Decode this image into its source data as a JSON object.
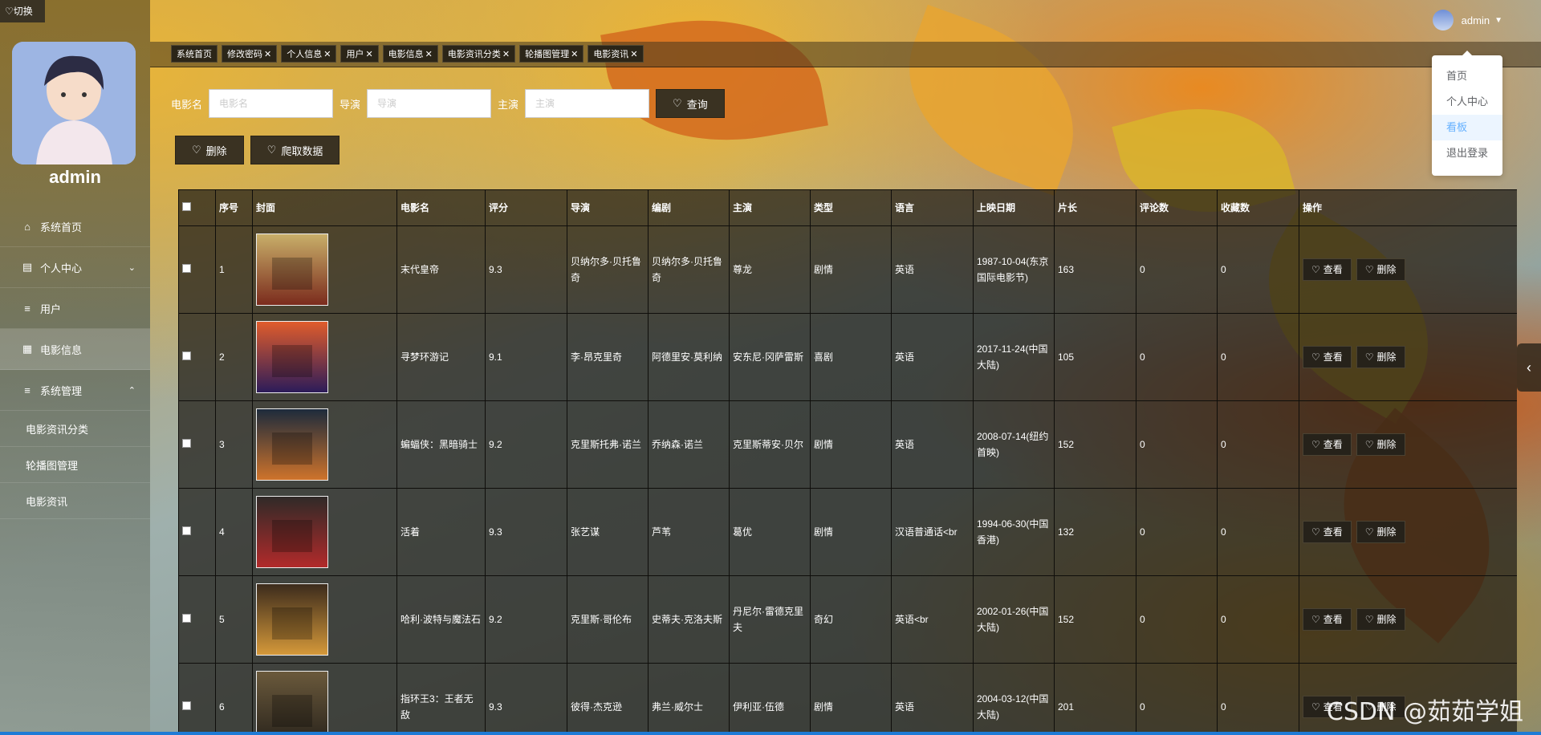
{
  "switch_label": "切换",
  "user": {
    "name": "admin"
  },
  "sidebar": {
    "items": [
      {
        "label": "系统首页",
        "icon": "home-icon"
      },
      {
        "label": "个人中心",
        "icon": "profile-icon"
      },
      {
        "label": "用户",
        "icon": "list-icon"
      },
      {
        "label": "电影信息",
        "icon": "grid-icon"
      },
      {
        "label": "系统管理",
        "icon": "list-icon"
      }
    ],
    "sub_items": [
      "电影资讯分类",
      "轮播图管理",
      "电影资讯"
    ]
  },
  "tabs": [
    "系统首页",
    "修改密码",
    "个人信息",
    "用户",
    "电影信息",
    "电影资讯分类",
    "轮播图管理",
    "电影资讯"
  ],
  "dropdown": [
    "首页",
    "个人中心",
    "看板",
    "退出登录"
  ],
  "search": {
    "fields": [
      {
        "label": "电影名",
        "placeholder": "电影名"
      },
      {
        "label": "导演",
        "placeholder": "导演"
      },
      {
        "label": "主演",
        "placeholder": "主演"
      }
    ],
    "button": "查询"
  },
  "actions": {
    "delete": "删除",
    "crawl": "爬取数据"
  },
  "table": {
    "headers": [
      "",
      "序号",
      "封面",
      "电影名",
      "评分",
      "导演",
      "编剧",
      "主演",
      "类型",
      "语言",
      "上映日期",
      "片长",
      "评论数",
      "收藏数",
      "操作"
    ],
    "rows": [
      {
        "no": "1",
        "name": "末代皇帝",
        "score": "9.3",
        "director": "贝纳尔多·贝托鲁奇",
        "writer": "贝纳尔多·贝托鲁奇",
        "cast": "尊龙",
        "genre": "剧情",
        "lang": "英语",
        "date": "1987-10-04(东京国际电影节)",
        "length": "163",
        "comments": "0",
        "favs": "0"
      },
      {
        "no": "2",
        "name": "寻梦环游记",
        "score": "9.1",
        "director": "李·昂克里奇",
        "writer": "阿德里安·莫利纳",
        "cast": "安东尼·冈萨雷斯",
        "genre": "喜剧",
        "lang": "英语",
        "date": "2017-11-24(中国大陆)",
        "length": "105",
        "comments": "0",
        "favs": "0"
      },
      {
        "no": "3",
        "name": "蝙蝠侠：黑暗骑士",
        "score": "9.2",
        "director": "克里斯托弗·诺兰",
        "writer": "乔纳森·诺兰",
        "cast": "克里斯蒂安·贝尔",
        "genre": "剧情",
        "lang": "英语",
        "date": "2008-07-14(纽约首映)",
        "length": "152",
        "comments": "0",
        "favs": "0"
      },
      {
        "no": "4",
        "name": "活着",
        "score": "9.3",
        "director": "张艺谋",
        "writer": "芦苇",
        "cast": "葛优",
        "genre": "剧情",
        "lang": "汉语普通话<br",
        "date": "1994-06-30(中国香港)",
        "length": "132",
        "comments": "0",
        "favs": "0"
      },
      {
        "no": "5",
        "name": "哈利·波特与魔法石",
        "score": "9.2",
        "director": "克里斯·哥伦布",
        "writer": "史蒂夫·克洛夫斯",
        "cast": "丹尼尔·雷德克里夫",
        "genre": "奇幻",
        "lang": "英语<br",
        "date": "2002-01-26(中国大陆)",
        "length": "152",
        "comments": "0",
        "favs": "0"
      },
      {
        "no": "6",
        "name": "指环王3：王者无敌",
        "score": "9.3",
        "director": "彼得·杰克逊",
        "writer": "弗兰·威尔士",
        "cast": "伊利亚·伍德",
        "genre": "剧情",
        "lang": "英语",
        "date": "2004-03-12(中国大陆)",
        "length": "201",
        "comments": "0",
        "favs": "0"
      }
    ],
    "view_label": "查看",
    "delete_label": "删除"
  },
  "watermark": "CSDN @茹茹学姐",
  "colors": {
    "primary_dark": "#3a3222",
    "accent_blue": "#1e7bd6"
  }
}
